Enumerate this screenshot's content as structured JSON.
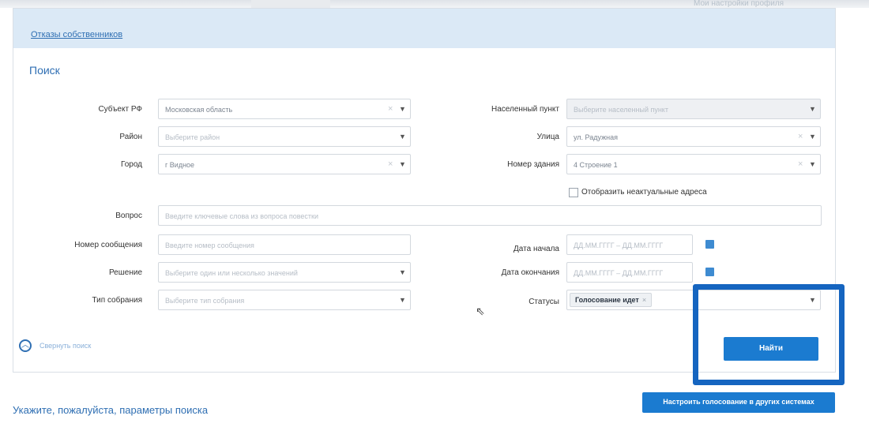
{
  "topbar": {
    "right_text": "Мои настройки профиля"
  },
  "header": {
    "owners_link": "Отказы собственников"
  },
  "search": {
    "title": "Поиск",
    "subject": {
      "label": "Субъект РФ",
      "value": "Московская область"
    },
    "district": {
      "label": "Район",
      "placeholder": "Выберите район"
    },
    "city": {
      "label": "Город",
      "value": "г Видное"
    },
    "settlement": {
      "label": "Населенный пункт",
      "placeholder": "Выберите населенный пункт"
    },
    "street": {
      "label": "Улица",
      "value": "ул. Радужная"
    },
    "building": {
      "label": "Номер здания",
      "value": "4 Строение 1"
    },
    "irrelevant_checkbox": "Отобразить неактуальные адреса",
    "question": {
      "label": "Вопрос",
      "placeholder": "Введите ключевые слова из вопроса повестки"
    },
    "message_no": {
      "label": "Номер сообщения",
      "placeholder": "Введите номер сообщения"
    },
    "decision": {
      "label": "Решение",
      "placeholder": "Выберите один или несколько значений"
    },
    "meeting_type": {
      "label": "Тип собрания",
      "placeholder": "Выберите тип собрания"
    },
    "date_start": {
      "label": "Дата начала",
      "placeholder": "ДД.ММ.ГГГГ – ДД.ММ.ГГГГ"
    },
    "date_end": {
      "label": "Дата окончания",
      "placeholder": "ДД.ММ.ГГГГ – ДД.ММ.ГГГГ"
    },
    "statuses": {
      "label": "Статусы",
      "tag": "Голосование идет"
    },
    "collapse_label": "Свернуть поиск",
    "find_button": "Найти"
  },
  "other_systems_button": "Настроить голосование в других системах",
  "hint": "Укажите, пожалуйста, параметры поиска",
  "icons": {
    "clear": "×",
    "dropdown": "▼",
    "calendar": "calendar-icon",
    "collapse": "chevron-up-icon"
  },
  "colors": {
    "accent": "#1b7bd0",
    "header_bg": "#dbe9f6",
    "highlight": "#1565c0"
  }
}
